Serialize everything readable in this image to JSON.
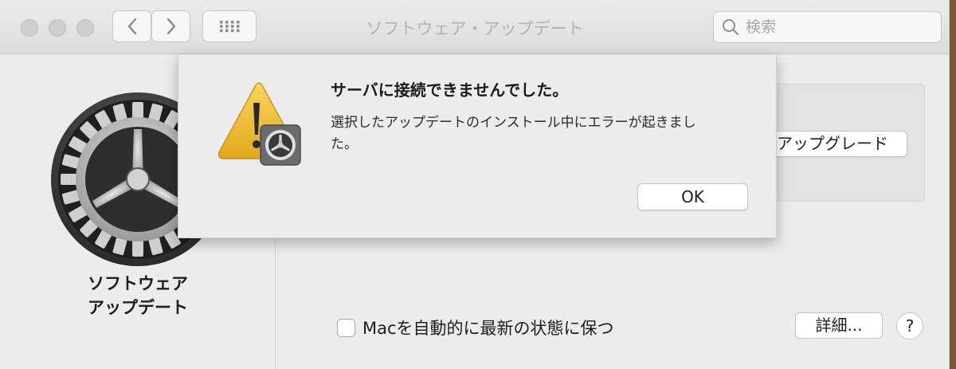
{
  "window": {
    "title": "ソフトウェア・アップデート",
    "search": {
      "placeholder": "検索",
      "value": ""
    }
  },
  "icons": {
    "back": "chevron-left-icon",
    "forward": "chevron-right-icon",
    "grid": "grid-icon",
    "search": "search-icon",
    "app": "gear-icon",
    "alert": "warning-icon"
  },
  "sidebar": {
    "app_name_line1": "ソフトウェア",
    "app_name_line2": "アップデート"
  },
  "main": {
    "upgrade_button_label": "アップグレード",
    "auto_update_label": "Macを自動的に最新の状態に保つ",
    "auto_update_checked": false,
    "details_button_label": "詳細...",
    "help_button_label": "?"
  },
  "alert": {
    "title": "サーバに接続できませんでした。",
    "message": "選択したアップデートのインストール中にエラーが起きました。",
    "ok_label": "OK"
  },
  "colors": {
    "window_bg": "#ececec",
    "warning_yellow": "#f2c12e",
    "gear_dark": "#3c3c3c"
  }
}
